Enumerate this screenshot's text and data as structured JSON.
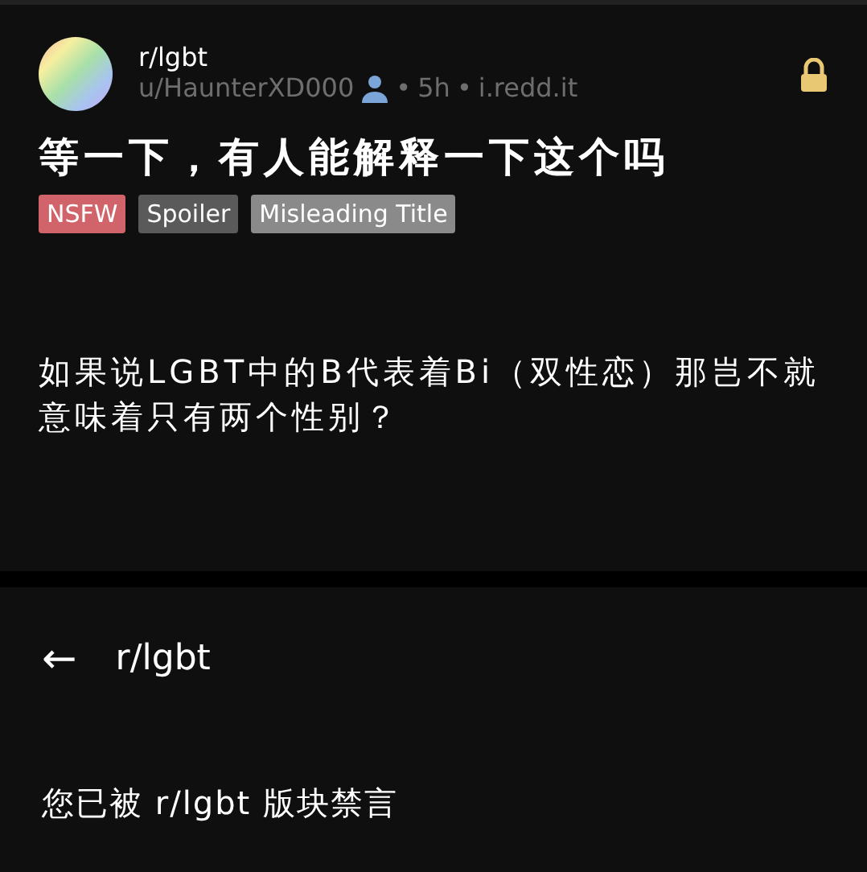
{
  "post": {
    "subreddit": "r/lgbt",
    "author": "u/HaunterXD000",
    "separator": "•",
    "age": "5h",
    "domain": "i.redd.it",
    "locked": true,
    "title": "等一下，有人能解释一下这个吗",
    "tags": [
      {
        "label": "NSFW",
        "color": "#d0646a"
      },
      {
        "label": "Spoiler",
        "color": "#5a5a5a"
      },
      {
        "label": "Misleading Title",
        "color": "#8a8a8a"
      }
    ],
    "body": "如果说LGBT中的B代表着Bi（双性恋）那岂不就意味着只有两个性别？"
  },
  "header": {
    "back": "←",
    "title": "r/lgbt"
  },
  "message": "您已被 r/lgbt 版块禁言"
}
